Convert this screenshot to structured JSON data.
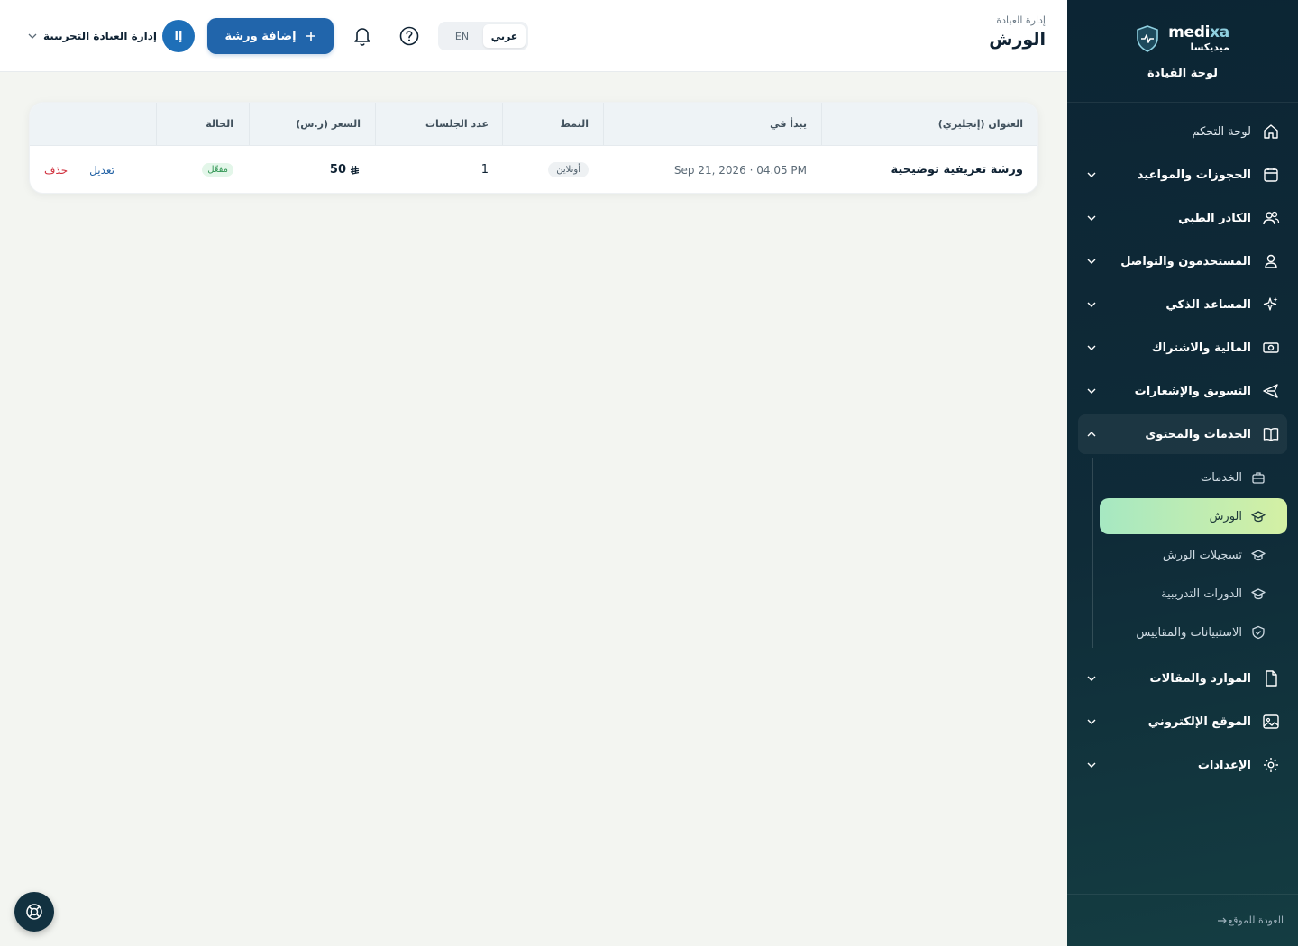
{
  "brand": {
    "name_en_a": "medi",
    "name_en_b": "xa",
    "name_ar": "ميديكسا",
    "subtitle": "لوحة القيادة"
  },
  "sidebar": {
    "items": [
      {
        "label": "لوحة التحكم",
        "icon": "home-icon"
      },
      {
        "label": "الحجوزات والمواعيد",
        "icon": "calendar-icon"
      },
      {
        "label": "الكادر الطبي",
        "icon": "users-icon"
      },
      {
        "label": "المستخدمون والتواصل",
        "icon": "user-icon"
      },
      {
        "label": "المساعد الذكي",
        "icon": "sparkles-icon"
      },
      {
        "label": "المالية والاشتراك",
        "icon": "money-icon"
      },
      {
        "label": "التسويق والإشعارات",
        "icon": "send-icon"
      },
      {
        "label": "الخدمات والمحتوى",
        "icon": "book-icon"
      },
      {
        "label": "الموارد والمقالات",
        "icon": "file-icon"
      },
      {
        "label": "الموقع الإلكتروني",
        "icon": "image-icon"
      },
      {
        "label": "الإعدادات",
        "icon": "gear-icon"
      }
    ],
    "subitems": [
      {
        "label": "الخدمات"
      },
      {
        "label": "الورش"
      },
      {
        "label": "تسجيلات الورش"
      },
      {
        "label": "الدورات التدريبية"
      },
      {
        "label": "الاستبيانات والمقاييس"
      }
    ],
    "footer": "العودة للموقع"
  },
  "header": {
    "breadcrumb": "إدارة العيادة",
    "title": "الورش",
    "lang_ar": "عربي",
    "lang_en": "EN",
    "add_button": "إضافة ورشة",
    "user_name": "إدارة العيادة التجريبية",
    "user_initial": "إا"
  },
  "table": {
    "columns": {
      "title": "العنوان (إنجليزي)",
      "starts": "يبدأ في",
      "mode": "النمط",
      "sessions": "عدد الجلسات",
      "price": "السعر (ر.س)",
      "status": "الحالة"
    },
    "row": {
      "title": "ورشة تعريفية توضيحية",
      "starts": "Sep 21, 2026 · 04.05 PM",
      "mode": "أونلاين",
      "sessions": "1",
      "price": "50",
      "status": "مفعّل",
      "edit": "تعديل",
      "delete": "حذف"
    }
  },
  "colors": {
    "sidebar_bg": "#0f2b38",
    "primary": "#2165ab",
    "active_item": "#c6eeb0",
    "danger": "#d02d3a",
    "success": "#2f9552"
  }
}
